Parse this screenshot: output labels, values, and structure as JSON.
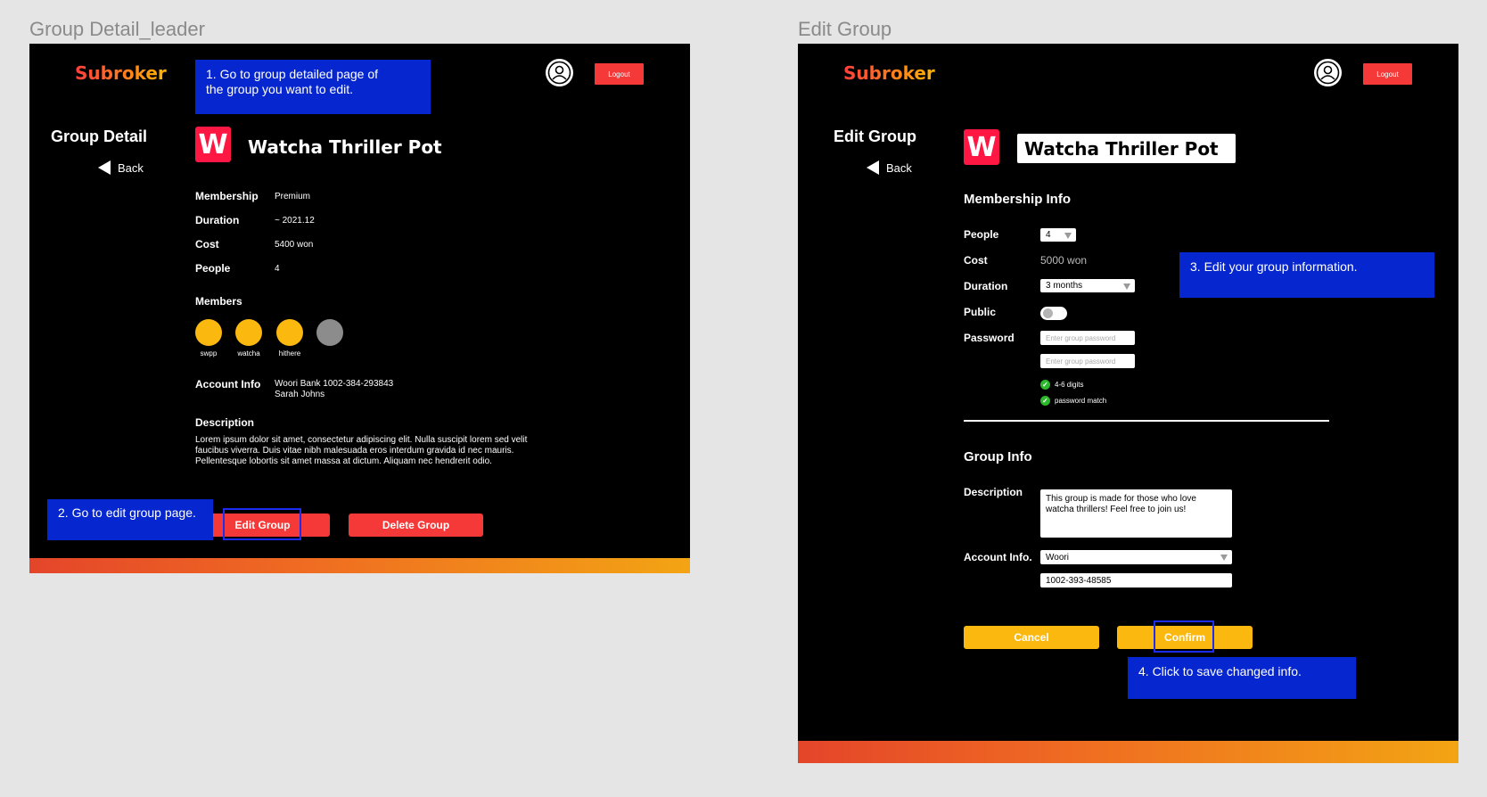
{
  "left": {
    "frame_title": "Group Detail_leader",
    "logo": "Subroker",
    "logout": "Logout",
    "heading": "Group Detail",
    "back": "Back",
    "app_icon_letter": "W",
    "group_name": "Watcha Thriller Pot",
    "fields": [
      {
        "label": "Membership",
        "value": "Premium"
      },
      {
        "label": "Duration",
        "value": "~ 2021.12"
      },
      {
        "label": "Cost",
        "value": "5400 won"
      },
      {
        "label": "People",
        "value": "4"
      }
    ],
    "members_label": "Members",
    "members": [
      "swpp",
      "watcha",
      "hithere",
      ""
    ],
    "account_label": "Account Info",
    "account_line1": "Woori Bank 1002-384-293843",
    "account_line2": "Sarah Johns",
    "description_label": "Description",
    "description": "Lorem ipsum dolor sit amet, consectetur adipiscing elit. Nulla suscipit lorem sed velit faucibus viverra. Duis vitae nibh malesuada eros interdum gravida id nec mauris. Pellentesque lobortis sit amet massa at dictum. Aliquam nec hendrerit odio.",
    "edit_button": "Edit Group",
    "delete_button": "Delete Group",
    "note1": "1. Go to group detailed page of\n    the group you want to edit.",
    "note2": "2. Go to edit group page."
  },
  "right": {
    "frame_title": "Edit Group",
    "logo": "Subroker",
    "logout": "Logout",
    "heading": "Edit Group",
    "back": "Back",
    "app_icon_letter": "W",
    "group_name_value": "Watcha Thriller Pot",
    "membership_info": "Membership Info",
    "people_label": "People",
    "people_value": "4",
    "cost_label": "Cost",
    "cost_value": "5000 won",
    "duration_label": "Duration",
    "duration_value": "3 months",
    "public_label": "Public",
    "password_label": "Password",
    "password_placeholder": "Enter group password",
    "check1": "4-6 digits",
    "check2": "password match",
    "group_info": "Group Info",
    "description_label": "Description",
    "description_value": "This group is made for those who love watcha thrillers! Feel free to join us!",
    "account_label": "Account Info.",
    "bank_value": "Woori",
    "account_number": "1002-393-48585",
    "cancel_button": "Cancel",
    "confirm_button": "Confirm",
    "note3": "3. Edit your group information.",
    "note4": "4. Click to save changed info."
  },
  "colors": {
    "accent_red": "#f53838",
    "accent_yellow": "#fbb80f",
    "note_blue": "#0626cf",
    "app_icon": "#ff1744"
  }
}
